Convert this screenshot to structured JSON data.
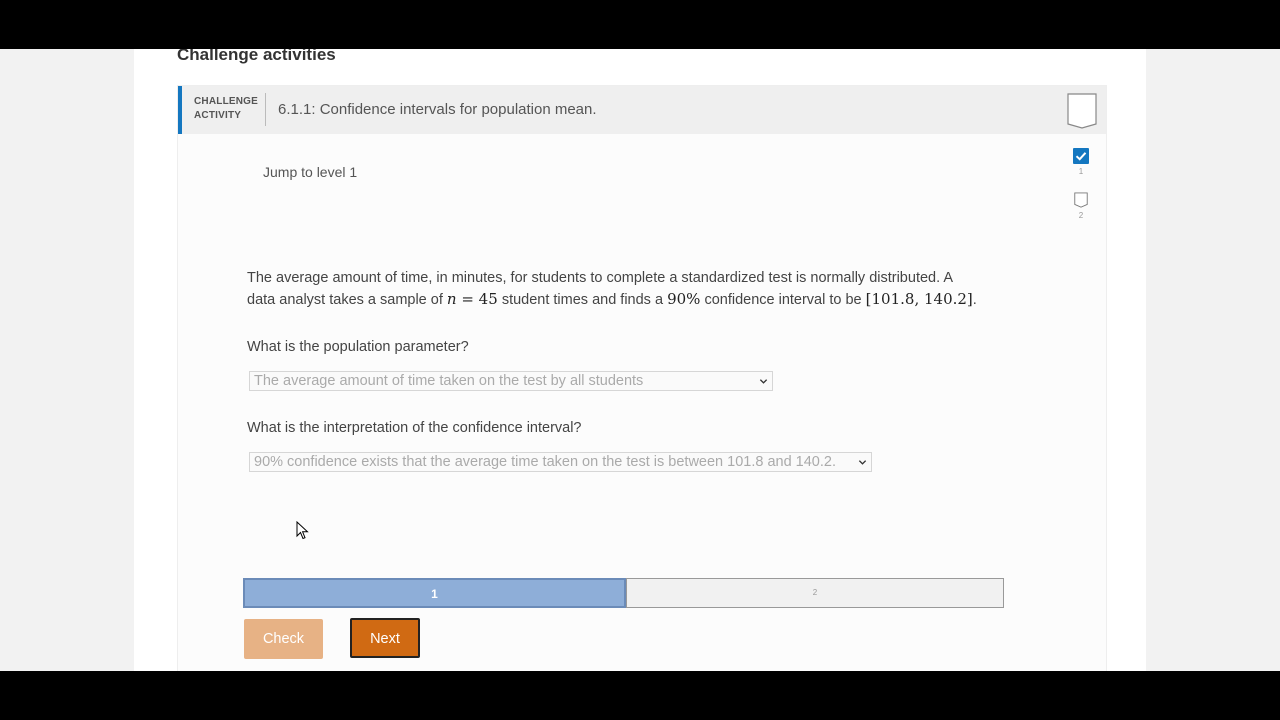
{
  "section": {
    "title": "Challenge activities"
  },
  "activity": {
    "label_line1": "CHALLENGE",
    "label_line2": "ACTIVITY",
    "title": "6.1.1: Confidence intervals for population mean."
  },
  "jump": {
    "label": "Jump to level 1"
  },
  "levels": [
    {
      "number": "1",
      "completed": true
    },
    {
      "number": "2",
      "completed": false
    }
  ],
  "problem": {
    "line1": "The average amount of time, in minutes, for students to complete a standardized test is normally distributed. A",
    "line2_a": "data analyst takes a sample of",
    "n_var": "n",
    "n_eq": " = 45",
    "line2_b": "student times and finds a",
    "conf": "90%",
    "line2_c": "confidence interval to be",
    "interval": "[101.8, 140.2]",
    "end": "."
  },
  "questions": [
    {
      "prompt": "What is the population parameter?",
      "selected": "The average amount of time taken on the test by all students"
    },
    {
      "prompt": "What is the interpretation of the confidence interval?",
      "selected": "90% confidence exists that the average time taken on the test is between 101.8 and 140.2."
    }
  ],
  "progress": {
    "segments": [
      "1",
      "2"
    ],
    "current": "1"
  },
  "buttons": {
    "check": "Check",
    "next": "Next"
  },
  "colors": {
    "accent": "#1477c0",
    "next": "#d06a13",
    "check": "#e7b285",
    "progress_active": "#8eaed8"
  }
}
